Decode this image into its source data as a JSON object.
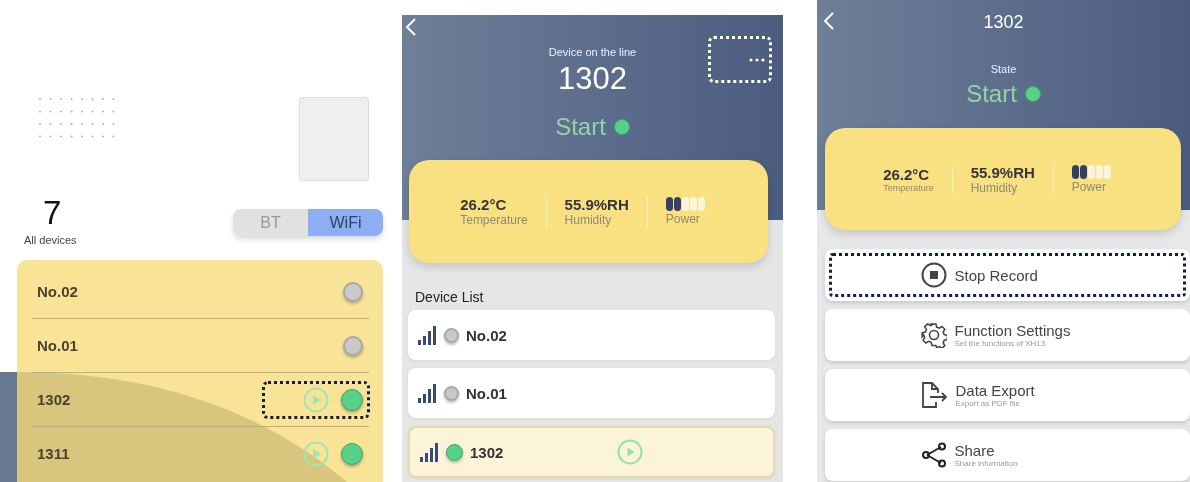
{
  "device_list_screen": {
    "count": "7",
    "count_label": "All devices",
    "toggle": [
      {
        "label": "BT",
        "selected": false
      },
      {
        "label": "WiFi",
        "selected": true
      }
    ],
    "devices": [
      {
        "name": "No.02",
        "online": false,
        "highlighted": false
      },
      {
        "name": "No.01",
        "online": false,
        "highlighted": false
      },
      {
        "name": "1302",
        "online": true,
        "highlighted": true
      },
      {
        "name": "1311",
        "online": true,
        "highlighted": false
      }
    ]
  },
  "device_screen": {
    "subtitle": "Device on the line",
    "device": "1302",
    "more_highlighted": true,
    "status": "Start",
    "status_on": true,
    "readings": [
      {
        "value": "26.2°C",
        "label": "Temperature"
      },
      {
        "value": "55.9%RH",
        "label": "Humidity"
      }
    ],
    "power": {
      "label": "Power",
      "level": 0.4
    },
    "list_title": "Device List",
    "devices": [
      {
        "name": "No.02",
        "online": false,
        "selected": false
      },
      {
        "name": "No.01",
        "online": false,
        "selected": false
      },
      {
        "name": "1302",
        "online": true,
        "selected": true
      }
    ]
  },
  "detail_screen": {
    "title": "1302",
    "status_label": "State",
    "status": "Start",
    "status_on": true,
    "readings": [
      {
        "value": "26.2°C",
        "label": "Temperature"
      },
      {
        "value": "55.9%RH",
        "label": "Humidity"
      }
    ],
    "power": {
      "label": "Power",
      "level": 0.4
    },
    "actions": [
      {
        "kind": "stop",
        "label": "Stop Record",
        "highlighted": true
      },
      {
        "kind": "settings",
        "label": "Function Settings",
        "subtitle": "Set the functions of XH13",
        "highlighted": false
      },
      {
        "kind": "export",
        "label": "Data Export",
        "subtitle": "Export as PDF file",
        "highlighted": false
      },
      {
        "kind": "share",
        "label": "Share",
        "subtitle": "Share information",
        "highlighted": false
      }
    ]
  }
}
